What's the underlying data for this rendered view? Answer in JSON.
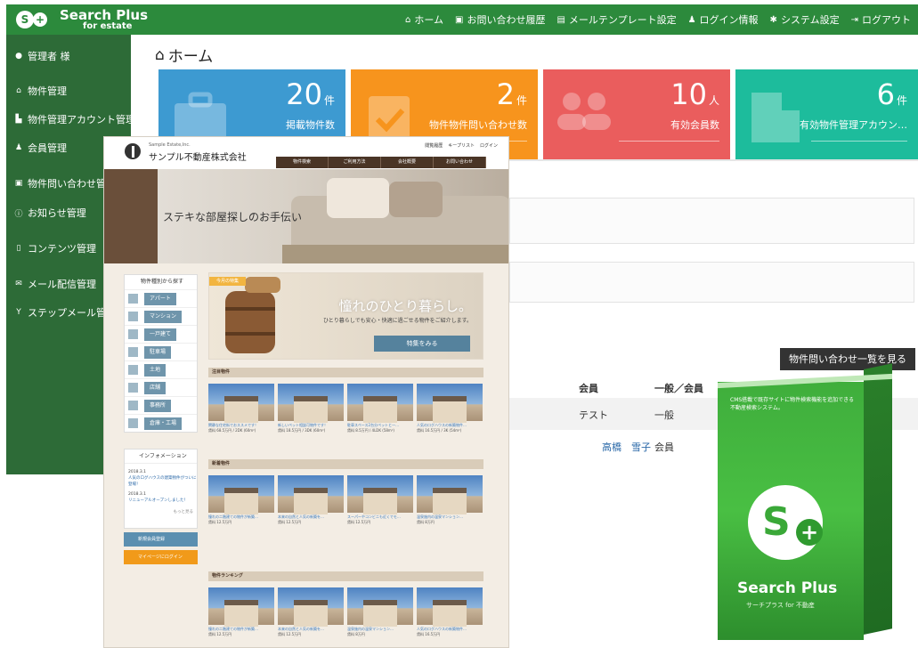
{
  "app": {
    "brand": "Search Plus",
    "brand_sub": "for estate"
  },
  "topnav": [
    {
      "icon": "home-icon",
      "label": "ホーム"
    },
    {
      "icon": "inbox-icon",
      "label": "お問い合わせ履歴"
    },
    {
      "icon": "document-icon",
      "label": "メールテンプレート設定"
    },
    {
      "icon": "user-key-icon",
      "label": "ログイン情報"
    },
    {
      "icon": "gear-icon",
      "label": "システム設定"
    },
    {
      "icon": "logout-icon",
      "label": "ログアウト"
    }
  ],
  "sidebar": {
    "user": "管理者 様",
    "items": [
      {
        "icon": "house-icon",
        "label": "物件管理"
      },
      {
        "icon": "building-icon",
        "label": "物件管理アカウント管理"
      },
      {
        "icon": "users-icon",
        "label": "会員管理"
      },
      {
        "icon": "inbox-icon",
        "label": "物件問い合わせ管理"
      },
      {
        "icon": "info-icon",
        "label": "お知らせ管理"
      },
      {
        "icon": "clipboard-icon",
        "label": "コンテンツ管理"
      },
      {
        "icon": "mail-icon",
        "label": "メール配信管理"
      },
      {
        "icon": "branch-icon",
        "label": "ステップメール管理"
      }
    ]
  },
  "page": {
    "title": "ホーム"
  },
  "cards": [
    {
      "value": "20",
      "unit": "件",
      "label": "掲載物件数",
      "color": "#3d9ad1",
      "icon": "briefcase-icon"
    },
    {
      "value": "2",
      "unit": "件",
      "label": "物件物件問い合わせ数",
      "color": "#f7941d",
      "icon": "clipboard-check-icon"
    },
    {
      "value": "10",
      "unit": "人",
      "label": "有効会員数",
      "color": "#ea5d5d",
      "icon": "users-icon"
    },
    {
      "value": "6",
      "unit": "件",
      "label": "有効物件管理アカウン…",
      "color": "#1dbc9c",
      "icon": "building-icon"
    }
  ],
  "inquiries": {
    "button_label": "物件問い合わせ一覧を見る",
    "headers": [
      "会員",
      "一般／会員"
    ],
    "rows": [
      {
        "member": "テスト",
        "type": "一般"
      },
      {
        "member": "高橋　雪子",
        "type": "会員"
      }
    ]
  },
  "site": {
    "company_small": "Sample Estate,Inc.",
    "company": "サンプル不動産株式会社",
    "toplinks": [
      "閲覧履歴",
      "キープリスト",
      "ログイン"
    ],
    "nav": [
      "物件検索",
      "ご利用方法",
      "会社概要",
      "お問い合わせ"
    ],
    "hero_text": "ステキな部屋探しのお手伝い",
    "category_title": "物件種別から探す",
    "categories": [
      "アパート",
      "マンション",
      "一戸建て",
      "駐車場",
      "土地",
      "店舗",
      "事務所",
      "倉庫・工場"
    ],
    "info_title": "インフォメーション",
    "info_lines": [
      "2018.3.1",
      "人気のログハウスの建築物件がついに",
      "登場！",
      "2018.3.1",
      "リニューアルオープンしました！",
      "もっと見る"
    ],
    "member_button": "新規会員登録",
    "mypage_button": "マイページにログイン",
    "feature_tag": "今月の特集",
    "feature_headline": "憧れのひとり暮らし。",
    "feature_sub": "ひとり暮らしでも安心・快適に過ごせる物件をご紹介します。",
    "feature_button": "特集をみる",
    "sections": [
      {
        "title": "注目物件",
        "items": [
          {
            "title": "閑静な住宅街でおススメです！",
            "price": "賃料 68.5万円 / 2DK (60m²)"
          },
          {
            "title": "新しいペット相談可物件です！",
            "price": "賃料 18.5万円 / 3DK (60m²)"
          },
          {
            "title": "駐車スペース2台分ペットと一…",
            "price": "賃料 8.5万円 / 4LDK (58m²)"
          },
          {
            "title": "人気のログハウスの新築物件…",
            "price": "賃料 16.5万円 / 3K (54m²)"
          }
        ]
      },
      {
        "title": "新着物件",
        "items": [
          {
            "title": "憧れの二階建ての物件が新築…",
            "price": "賃料 12.5万円"
          },
          {
            "title": "本来の自然と人気の新築を…",
            "price": "賃料 12.5万円"
          },
          {
            "title": "スーパーやコンビニも近くでモ…",
            "price": "賃料 12.5万円"
          },
          {
            "title": "温泉施内の温泉マンション…",
            "price": "賃料 8万円"
          }
        ]
      },
      {
        "title": "物件ランキング",
        "items": [
          {
            "title": "憧れの二階建ての物件が新築…",
            "price": "賃料 12.5万円"
          },
          {
            "title": "本来の自然と人気の新築を…",
            "price": "賃料 12.5万円"
          },
          {
            "title": "温泉施内の温泉マンション…",
            "price": "賃料 8万円"
          },
          {
            "title": "人気のログハウスの新築物件…",
            "price": "賃料 16.5万円"
          }
        ]
      }
    ]
  },
  "product_box": {
    "desc": "CMS搭載で既存サイトに物件検索機能を追加できる不動産検索システム。",
    "name": "Search Plus",
    "sub": "サーチプラス for 不動産"
  }
}
